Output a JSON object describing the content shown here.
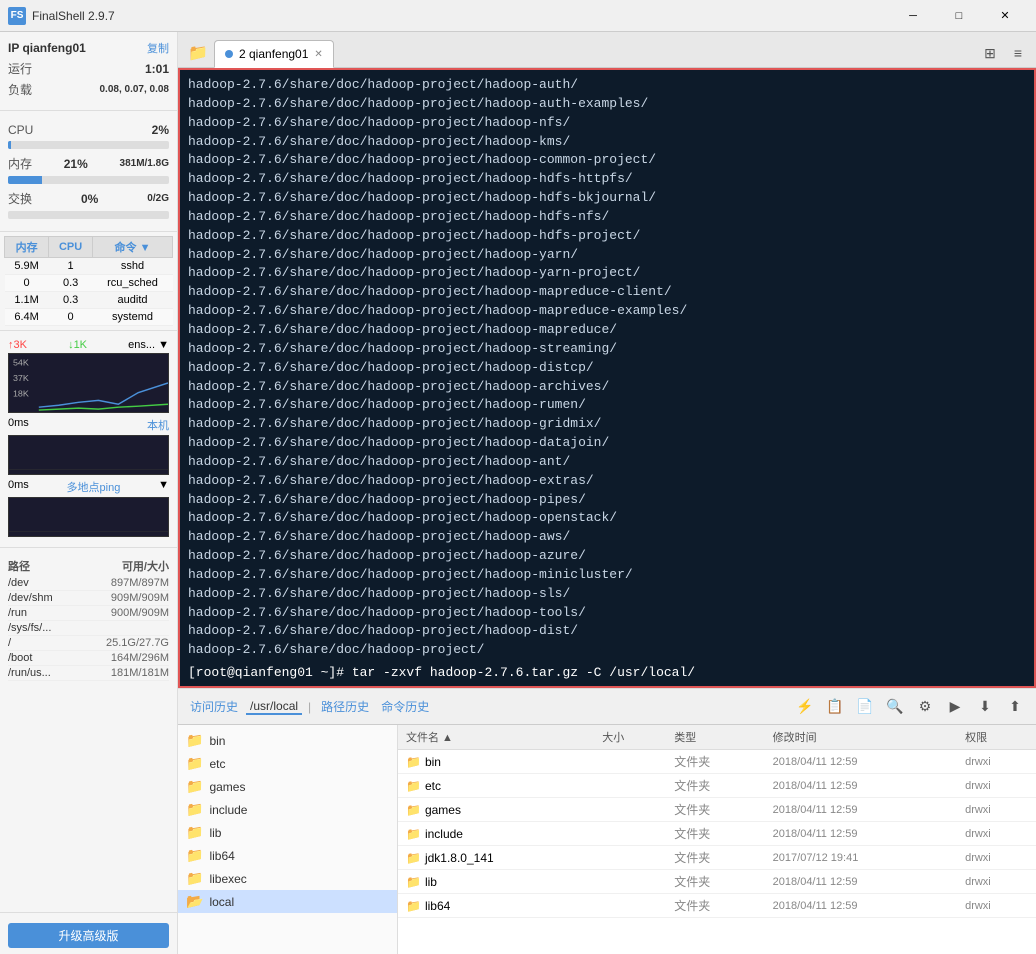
{
  "app": {
    "title": "FinalShell 2.9.7",
    "icon": "FS"
  },
  "titlebar": {
    "minimize": "─",
    "maximize": "□",
    "close": "✕"
  },
  "sidebar": {
    "ip_label": "IP qianfeng01",
    "copy_label": "复制",
    "runtime_label": "运行",
    "runtime_value": "1:01",
    "load_label": "负载",
    "load_value": "0.08, 0.07, 0.08",
    "cpu_label": "CPU",
    "cpu_value": "2%",
    "mem_label": "内存",
    "mem_percent": "21%",
    "mem_value": "381M/1.8G",
    "swap_label": "交换",
    "swap_percent": "0%",
    "swap_value": "0/2G",
    "proc_headers": [
      "内存",
      "CPU",
      "命令"
    ],
    "processes": [
      {
        "mem": "5.9M",
        "cpu": "1",
        "cmd": "sshd"
      },
      {
        "mem": "0",
        "cpu": "0.3",
        "cmd": "rcu_sched"
      },
      {
        "mem": "1.1M",
        "cpu": "0.3",
        "cmd": "auditd"
      },
      {
        "mem": "6.4M",
        "cpu": "0",
        "cmd": "systemd"
      }
    ],
    "net_up_label": "↑3K",
    "net_down_label": "↓1K",
    "net_suffix": "ens...",
    "net_values": [
      "54K",
      "37K",
      "18K"
    ],
    "ping_label": "0ms",
    "ping_type": "本机",
    "ping_values": [
      0,
      0,
      0
    ],
    "multiping_label": "0ms",
    "multiping_type": "多地点ping",
    "multiping_values": [
      0,
      0,
      0
    ],
    "disk_header_path": "路径",
    "disk_header_size": "可用/大小",
    "disks": [
      {
        "path": "/dev",
        "size": "897M/897M"
      },
      {
        "path": "/dev/shm",
        "size": "909M/909M"
      },
      {
        "path": "/run",
        "size": "900M/909M"
      },
      {
        "path": "/sys/fs/...",
        "size": ""
      },
      {
        "path": "/",
        "size": "25.1G/27.7G"
      },
      {
        "path": "/boot",
        "size": "164M/296M"
      },
      {
        "path": "/run/us...",
        "size": "181M/181M"
      }
    ],
    "upgrade_label": "升级高级版"
  },
  "tabs": [
    {
      "label": "2 qianfeng01",
      "active": true
    }
  ],
  "terminal": {
    "lines": [
      "hadoop-2.7.6/share/doc/hadoop-project/hadoop-auth/",
      "hadoop-2.7.6/share/doc/hadoop-project/hadoop-auth-examples/",
      "hadoop-2.7.6/share/doc/hadoop-project/hadoop-nfs/",
      "hadoop-2.7.6/share/doc/hadoop-project/hadoop-kms/",
      "hadoop-2.7.6/share/doc/hadoop-project/hadoop-common-project/",
      "hadoop-2.7.6/share/doc/hadoop-project/hadoop-hdfs-httpfs/",
      "hadoop-2.7.6/share/doc/hadoop-project/hadoop-hdfs-bkjournal/",
      "hadoop-2.7.6/share/doc/hadoop-project/hadoop-hdfs-nfs/",
      "hadoop-2.7.6/share/doc/hadoop-project/hadoop-hdfs-project/",
      "hadoop-2.7.6/share/doc/hadoop-project/hadoop-yarn/",
      "hadoop-2.7.6/share/doc/hadoop-project/hadoop-yarn-project/",
      "hadoop-2.7.6/share/doc/hadoop-project/hadoop-mapreduce-client/",
      "hadoop-2.7.6/share/doc/hadoop-project/hadoop-mapreduce-examples/",
      "hadoop-2.7.6/share/doc/hadoop-project/hadoop-mapreduce/",
      "hadoop-2.7.6/share/doc/hadoop-project/hadoop-streaming/",
      "hadoop-2.7.6/share/doc/hadoop-project/hadoop-distcp/",
      "hadoop-2.7.6/share/doc/hadoop-project/hadoop-archives/",
      "hadoop-2.7.6/share/doc/hadoop-project/hadoop-rumen/",
      "hadoop-2.7.6/share/doc/hadoop-project/hadoop-gridmix/",
      "hadoop-2.7.6/share/doc/hadoop-project/hadoop-datajoin/",
      "hadoop-2.7.6/share/doc/hadoop-project/hadoop-ant/",
      "hadoop-2.7.6/share/doc/hadoop-project/hadoop-extras/",
      "hadoop-2.7.6/share/doc/hadoop-project/hadoop-pipes/",
      "hadoop-2.7.6/share/doc/hadoop-project/hadoop-openstack/",
      "hadoop-2.7.6/share/doc/hadoop-project/hadoop-aws/",
      "hadoop-2.7.6/share/doc/hadoop-project/hadoop-azure/",
      "hadoop-2.7.6/share/doc/hadoop-project/hadoop-minicluster/",
      "hadoop-2.7.6/share/doc/hadoop-project/hadoop-sls/",
      "hadoop-2.7.6/share/doc/hadoop-project/hadoop-tools/",
      "hadoop-2.7.6/share/doc/hadoop-project/hadoop-dist/",
      "hadoop-2.7.6/share/doc/hadoop-project/"
    ],
    "command_line": "[root@qianfeng01 ~]# tar -zxvf hadoop-2.7.6.tar.gz -C /usr/local/"
  },
  "toolbar": {
    "access_history": "访问历史",
    "current_path": "/usr/local",
    "path_history": "路径历史",
    "cmd_history": "命令历史",
    "buttons": [
      "⟳",
      "↑",
      "⬇",
      "⬆",
      "|",
      "⬇"
    ]
  },
  "filemanager": {
    "left_folders": [
      "bin",
      "etc",
      "games",
      "include",
      "lib",
      "lib64",
      "libexec",
      "local"
    ],
    "right_columns": [
      "文件名",
      "大小",
      "类型",
      "修改时间",
      "权限"
    ],
    "right_files": [
      {
        "name": "bin",
        "size": "",
        "type": "文件夹",
        "date": "2018/04/11 12:59",
        "perm": "drwxi"
      },
      {
        "name": "etc",
        "size": "",
        "type": "文件夹",
        "date": "2018/04/11 12:59",
        "perm": "drwxi"
      },
      {
        "name": "games",
        "size": "",
        "type": "文件夹",
        "date": "2018/04/11 12:59",
        "perm": "drwxi"
      },
      {
        "name": "include",
        "size": "",
        "type": "文件夹",
        "date": "2018/04/11 12:59",
        "perm": "drwxi"
      },
      {
        "name": "jdk1.8.0_141",
        "size": "",
        "type": "文件夹",
        "date": "2017/07/12 19:41",
        "perm": "drwxi"
      },
      {
        "name": "lib",
        "size": "",
        "type": "文件夹",
        "date": "2018/04/11 12:59",
        "perm": "drwxi"
      },
      {
        "name": "lib64",
        "size": "",
        "type": "文件夹",
        "date": "2018/04/11 12:59",
        "perm": "drwxi"
      }
    ]
  }
}
